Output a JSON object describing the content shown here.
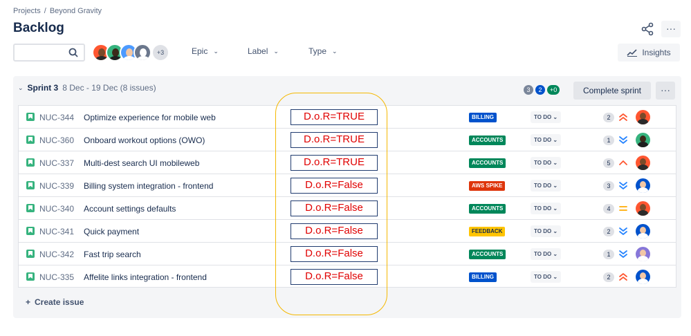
{
  "breadcrumb": {
    "project": "Projects",
    "separator": "/",
    "current": "Beyond Gravity"
  },
  "page_title": "Backlog",
  "toolbar": {
    "search_value": "",
    "avatars": [
      {
        "bg": "#ff5630",
        "face": "#7a4a2a",
        "body": "#2b2b2b"
      },
      {
        "bg": "#36b37e",
        "face": "#3b2a1a",
        "body": "#1f1f1f"
      },
      {
        "bg": "#4c9aff",
        "face": "#f2c7a5",
        "body": "#ffffff"
      },
      {
        "bg": "#6b778c",
        "face": "#ffffff",
        "body": "#ffffff"
      }
    ],
    "avatar_more": "+3",
    "filters": [
      {
        "label": "Epic"
      },
      {
        "label": "Label"
      },
      {
        "label": "Type"
      }
    ],
    "insights_label": "Insights"
  },
  "sprint": {
    "name": "Sprint 3",
    "meta": "8 Dec - 19 Dec (8 issues)",
    "counts": [
      {
        "value": "3",
        "color": "#7a869a"
      },
      {
        "value": "2",
        "color": "#0052cc"
      },
      {
        "value": "+0",
        "color": "#00875a"
      }
    ],
    "complete_label": "Complete sprint",
    "more_label": "···"
  },
  "issues": [
    {
      "key": "NUC-344",
      "summary": "Optimize experience for mobile web",
      "dor": "D.o.R=TRUE",
      "label": "BILLING",
      "label_color": "#0052cc",
      "status": "TO DO ⌄",
      "points": "2",
      "priority": "highest",
      "priority_color": "#ff5630",
      "avatar": {
        "bg": "#ff5630",
        "face": "#7a4a2a",
        "body": "#2b2b2b"
      }
    },
    {
      "key": "NUC-360",
      "summary": "Onboard workout options (OWO)",
      "dor": "D.o.R=TRUE",
      "label": "ACCOUNTS",
      "label_color": "#00875a",
      "status": "TO DO ⌄",
      "points": "1",
      "priority": "lowest",
      "priority_color": "#2684ff",
      "avatar": {
        "bg": "#36b37e",
        "face": "#3b2a1a",
        "body": "#1f1f1f"
      }
    },
    {
      "key": "NUC-337",
      "summary": "Multi-dest search UI mobileweb",
      "dor": "D.o.R=TRUE",
      "label": "ACCOUNTS",
      "label_color": "#00875a",
      "status": "TO DO ⌄",
      "points": "5",
      "priority": "high",
      "priority_color": "#ff5630",
      "avatar": {
        "bg": "#ff5630",
        "face": "#7a4a2a",
        "body": "#2b2b2b"
      }
    },
    {
      "key": "NUC-339",
      "summary": "Billing system integration - frontend",
      "dor": "D.o.R=False",
      "label": "AWS SPIKE",
      "label_color": "#de350b",
      "status": "TO DO ⌄",
      "points": "3",
      "priority": "lowest",
      "priority_color": "#2684ff",
      "avatar": {
        "bg": "#0052cc",
        "face": "#f2c7a5",
        "body": "#ffffff"
      }
    },
    {
      "key": "NUC-340",
      "summary": "Account settings defaults",
      "dor": "D.o.R=False",
      "label": "ACCOUNTS",
      "label_color": "#00875a",
      "status": "TO DO ⌄",
      "points": "4",
      "priority": "medium",
      "priority_color": "#ffab00",
      "avatar": {
        "bg": "#ff5630",
        "face": "#7a4a2a",
        "body": "#2b2b2b"
      }
    },
    {
      "key": "NUC-341",
      "summary": "Quick payment",
      "dor": "D.o.R=False",
      "label": "FEEDBACK",
      "label_color": "#ffc400",
      "status": "TO DO ⌄",
      "points": "2",
      "priority": "lowest",
      "priority_color": "#2684ff",
      "avatar": {
        "bg": "#0052cc",
        "face": "#f2c7a5",
        "body": "#ffffff"
      }
    },
    {
      "key": "NUC-342",
      "summary": "Fast trip search",
      "dor": "D.o.R=False",
      "label": "ACCOUNTS",
      "label_color": "#00875a",
      "status": "TO DO ⌄",
      "points": "1",
      "priority": "lowest",
      "priority_color": "#2684ff",
      "avatar": {
        "bg": "#8777d9",
        "face": "#f2c7a5",
        "body": "#ffffff"
      }
    },
    {
      "key": "NUC-335",
      "summary": "Affelite links integration - frontend",
      "dor": "D.o.R=False",
      "label": "BILLING",
      "label_color": "#0052cc",
      "status": "TO DO ⌄",
      "points": "2",
      "priority": "highest",
      "priority_color": "#ff5630",
      "avatar": {
        "bg": "#0052cc",
        "face": "#f2c7a5",
        "body": "#ffffff"
      }
    }
  ],
  "create_issue": {
    "icon": "+",
    "label": "Create issue"
  },
  "colors": {
    "accent": "#0052cc",
    "annotation_oval": "#f5b800",
    "dor_text": "#e00000"
  }
}
